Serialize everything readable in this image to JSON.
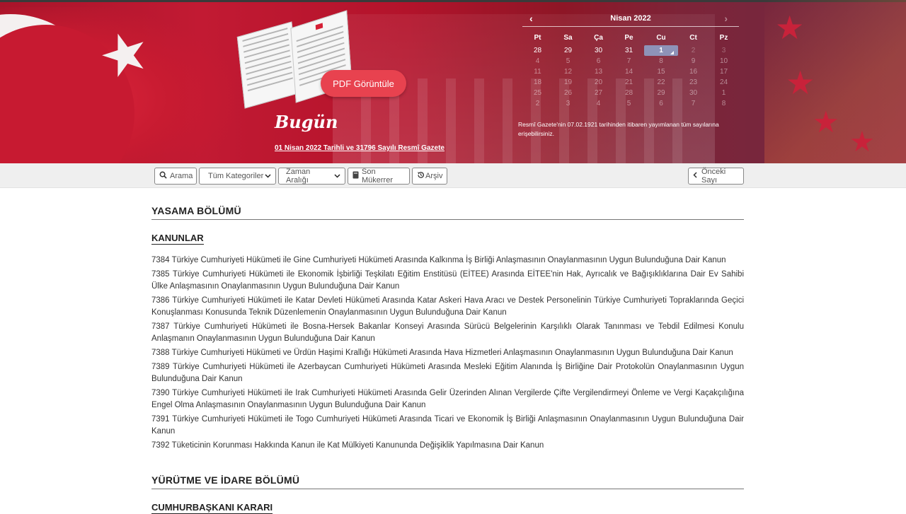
{
  "hero": {
    "pdf_button": "PDF Görüntüle",
    "today_title": "Bugün",
    "today_link": "01 Nisan 2022 Tarihli ve 31796 Sayılı Resmî Gazete",
    "note": "Resmî Gazete'nin 07.02.1921 tarihinden itibaren yayımlanan tüm sayılarına erişebilirsiniz."
  },
  "calendar": {
    "month_label": "Nisan 2022",
    "weekdays": [
      "Pt",
      "Sa",
      "Ça",
      "Pe",
      "Cu",
      "Ct",
      "Pz"
    ],
    "weeks": [
      [
        "28",
        "29",
        "30",
        "31",
        "1",
        "2",
        "3"
      ],
      [
        "4",
        "5",
        "6",
        "7",
        "8",
        "9",
        "10"
      ],
      [
        "11",
        "12",
        "13",
        "14",
        "15",
        "16",
        "17"
      ],
      [
        "18",
        "19",
        "20",
        "21",
        "22",
        "23",
        "24"
      ],
      [
        "25",
        "26",
        "27",
        "28",
        "29",
        "30",
        "1"
      ],
      [
        "2",
        "3",
        "4",
        "5",
        "6",
        "7",
        "8"
      ]
    ],
    "selected": "1"
  },
  "toolbar": {
    "search": "Arama",
    "categories": "Tüm Kategoriler",
    "time_range": "Zaman Aralığı",
    "repeat": "Son Mükerrer",
    "archive": "Arşiv",
    "previous": "Önceki Sayı"
  },
  "sections": {
    "legislation": "YASAMA BÖLÜMÜ",
    "laws": "KANUNLAR",
    "executive": "YÜRÜTME VE İDARE BÖLÜMÜ",
    "presidential": "CUMHURBAŞKANI KARARI"
  },
  "laws": [
    "7384 Türkiye Cumhuriyeti Hükümeti ile Gine Cumhuriyeti Hükümeti Arasında Kalkınma İş Birliği Anlaşmasının Onaylanmasının Uygun Bulunduğuna Dair Kanun",
    "7385 Türkiye Cumhuriyeti Hükümeti ile Ekonomik İşbirliği Teşkilatı Eğitim Enstitüsü (EİTEE) Arasında EİTEE'nin Hak, Ayrıcalık ve Bağışıklıklarına Dair Ev Sahibi Ülke Anlaşmasının Onaylanmasının Uygun Bulunduğuna Dair Kanun",
    "7386 Türkiye Cumhuriyeti Hükümeti ile Katar Devleti Hükümeti Arasında Katar Askeri Hava Aracı ve Destek Personelinin Türkiye Cumhuriyeti Topraklarında Geçici Konuşlanması Konusunda Teknik Düzenlemenin Onaylanmasının Uygun Bulunduğuna Dair Kanun",
    "7387 Türkiye Cumhuriyeti Hükümeti ile Bosna-Hersek Bakanlar Konseyi Arasında Sürücü Belgelerinin Karşılıklı Olarak Tanınması ve Tebdil Edilmesi Konulu Anlaşmanın Onaylanmasının Uygun Bulunduğuna Dair Kanun",
    "7388 Türkiye Cumhuriyeti Hükümeti ve Ürdün Haşimi Krallığı Hükümeti Arasında Hava Hizmetleri Anlaşmasının Onaylanmasının Uygun Bulunduğuna Dair Kanun",
    "7389 Türkiye Cumhuriyeti Hükümeti ile Azerbaycan Cumhuriyeti Hükümeti Arasında Mesleki Eğitim Alanında İş Birliğine Dair Protokolün Onaylanmasının Uygun Bulunduğuna Dair Kanun",
    "7390 Türkiye Cumhuriyeti Hükümeti ile Irak Cumhuriyeti Hükümeti Arasında Gelir Üzerinden Alınan Vergilerde Çifte Vergilendirmeyi Önleme ve Vergi Kaçakçılığına Engel Olma Anlaşmasının Onaylanmasının Uygun Bulunduğuna Dair Kanun",
    "7391 Türkiye Cumhuriyeti Hükümeti ile Togo Cumhuriyeti Hükümeti Arasında Ticari ve Ekonomik İş Birliği Anlaşmasının Onaylanmasının Uygun Bulunduğuna Dair Kanun",
    "7392 Tüketicinin Korunması Hakkında Kanun ile Kat Mülkiyeti Kanununda Değişiklik Yapılmasına Dair Kanun"
  ],
  "icons": {
    "prev": "chevron-left-icon",
    "next": "chevron-right-icon",
    "search": "search-icon",
    "book": "book-icon",
    "history": "history-icon"
  }
}
